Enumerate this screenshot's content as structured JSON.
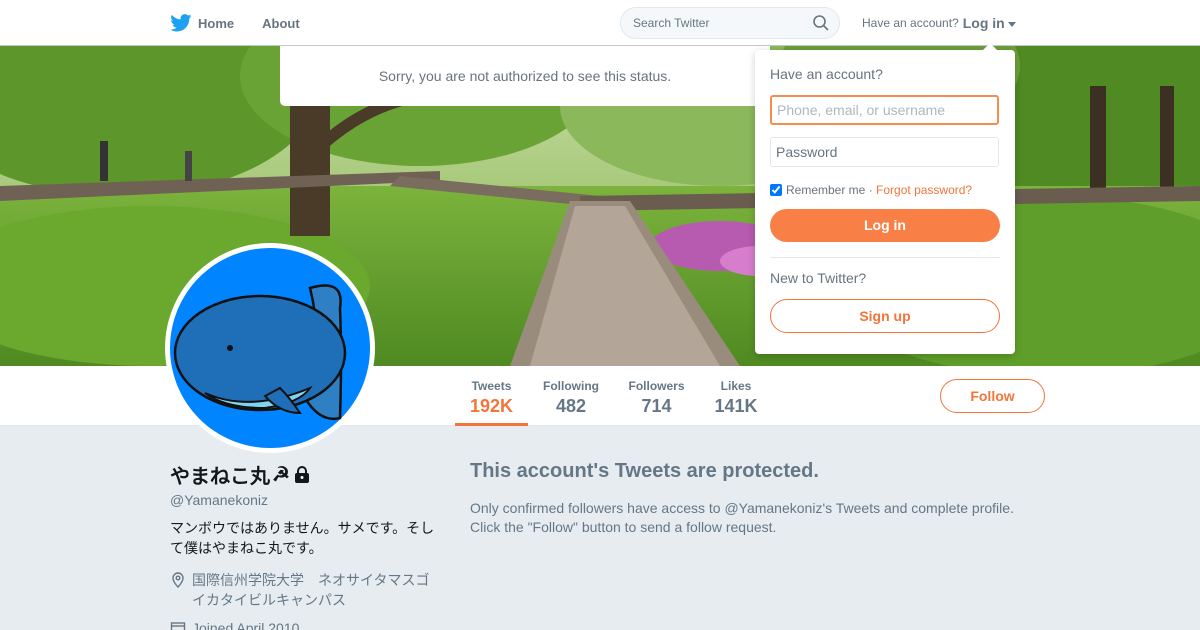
{
  "nav": {
    "home_label": "Home",
    "about_label": "About",
    "search_placeholder": "Search Twitter",
    "have_account": "Have an account?",
    "login_label": "Log in"
  },
  "notice": "Sorry, you are not authorized to see this status.",
  "login_dropdown": {
    "title": "Have an account?",
    "username_placeholder": "Phone, email, or username",
    "password_placeholder": "Password",
    "remember_label": "Remember me",
    "separator": "·",
    "forgot_label": "Forgot password?",
    "login_button": "Log in",
    "new_label": "New to Twitter?",
    "signup_button": "Sign up"
  },
  "stats": [
    {
      "label": "Tweets",
      "value": "192K",
      "active": true
    },
    {
      "label": "Following",
      "value": "482"
    },
    {
      "label": "Followers",
      "value": "714"
    },
    {
      "label": "Likes",
      "value": "141K"
    }
  ],
  "follow_button": "Follow",
  "profile": {
    "name": "やまねこ丸",
    "name_emoji": "☭",
    "handle": "@Yamanekoniz",
    "bio": "マンボウではありません。サメです。そして僕はやまねこ丸です。",
    "location": "国際信州学院大学　ネオサイタマスゴイカタイビルキャンパス",
    "joined": "Joined April 2010"
  },
  "protected": {
    "title": "This account's Tweets are protected.",
    "line1": "Only confirmed followers have access to @Yamanekoniz's Tweets and complete profile.",
    "line2": "Click the \"Follow\" button to send a follow request."
  },
  "colors": {
    "accent": "#f4743b",
    "twitter_blue": "#1da1f2",
    "avatar_bg": "#0084ff"
  }
}
